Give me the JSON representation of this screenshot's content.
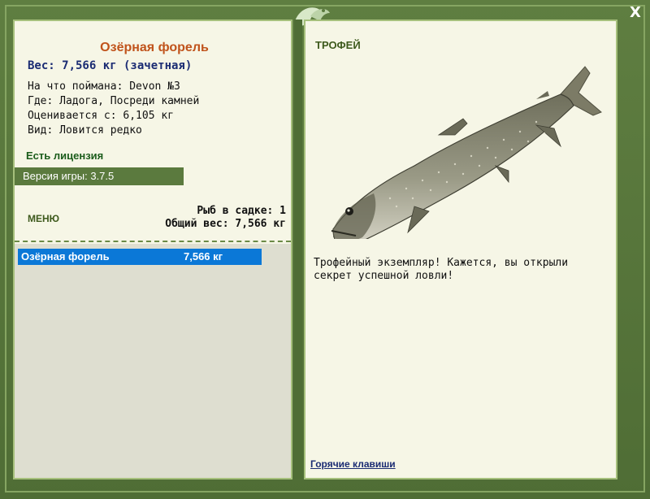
{
  "window": {
    "close_label": "X"
  },
  "left_panel": {
    "fish_name": "Озёрная форель",
    "weight_line": "Вес: 7,566 кг (зачетная)",
    "info": [
      "На что поймана: Devon №3",
      "Где: Ладога, Посреди камней",
      "Оценивается с: 6,105 кг",
      "Вид: Ловится редко"
    ],
    "license": "Есть лицензия",
    "version": "Версия игры: 3.7.5",
    "menu_label": "МЕНЮ",
    "stats": {
      "fish_count": "Рыб в садке: 1",
      "total_weight": "Общий вес: 7,566 кг"
    },
    "list": [
      {
        "name": "Озёрная форель",
        "weight": "7,566 кг",
        "selected": true
      }
    ]
  },
  "right_panel": {
    "trophy_label": "ТРОФЕЙ",
    "description": "Трофейный экземпляр! Кажется, вы открыли секрет успешной ловли!",
    "hotkeys_link": "Горячие клавиши"
  },
  "colors": {
    "frame": "#5b7a3e",
    "panel": "#f6f6e6",
    "title": "#c0531b",
    "weight": "#1b2c73",
    "selection": "#0b78d7"
  },
  "icons": {
    "logo": "fish-leaf-logo-icon",
    "close": "close-icon",
    "trophy_fish": "lake-trout-illustration"
  }
}
